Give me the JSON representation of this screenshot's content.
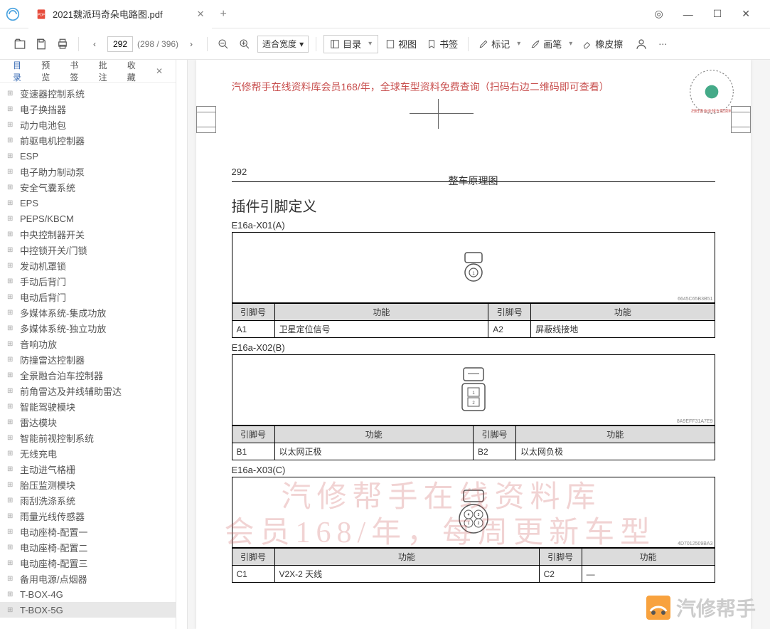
{
  "tab": {
    "title": "2021魏派玛奇朵电路图.pdf"
  },
  "toolbar": {
    "page_current": "292",
    "page_count": "(298 / 396)",
    "zoom": "适合宽度",
    "outline": "目录",
    "view": "视图",
    "bookmark": "书签",
    "annotate": "标记",
    "brush": "画笔",
    "eraser": "橡皮擦"
  },
  "side_tabs": {
    "outline": "目录",
    "preview": "预览",
    "bookmark": "书签",
    "annot": "批注",
    "fav": "收藏"
  },
  "tree": [
    "变速器控制系统",
    "电子换挡器",
    "动力电池包",
    "前驱电机控制器",
    "ESP",
    "电子助力制动泵",
    "安全气囊系统",
    "EPS",
    "PEPS/KBCM",
    "中央控制器开关",
    "中控锁开关/门锁",
    "发动机罩锁",
    "手动后背门",
    "电动后背门",
    "多媒体系统-集成功放",
    "多媒体系统-独立功放",
    "音响功放",
    "防撞雷达控制器",
    "全景融合泊车控制器",
    "前角雷达及并线辅助雷达",
    "智能驾驶模块",
    "雷达模块",
    "智能前视控制系统",
    "无线充电",
    "主动进气格栅",
    "胎压监测模块",
    "雨刮洗涤系统",
    "雨量光线传感器",
    "电动座椅-配置一",
    "电动座椅-配置二",
    "电动座椅-配置三",
    "备用电源/点烟器",
    "T-BOX-4G",
    "T-BOX-5G"
  ],
  "tree_selected_index": 33,
  "doc": {
    "banner": "汽修帮手在线资料库会员168/年，全球车型资料免费查询（扫码右边二维码即可查看）",
    "page_no": "292",
    "right_header": "整车原理图",
    "section_title": "插件引脚定义",
    "connectors": [
      {
        "label": "E16a-X01(A)",
        "serial": "6645C65B3B51",
        "headers": [
          "引脚号",
          "功能",
          "引脚号",
          "功能"
        ],
        "rows": [
          [
            "A1",
            "卫星定位信号",
            "A2",
            "屏蔽线接地"
          ]
        ]
      },
      {
        "label": "E16a-X02(B)",
        "serial": "8A9EFF31A7E9",
        "headers": [
          "引脚号",
          "功能",
          "引脚号",
          "功能"
        ],
        "rows": [
          [
            "B1",
            "以太网正极",
            "B2",
            "以太网负极"
          ]
        ]
      },
      {
        "label": "E16a-X03(C)",
        "serial": "4D7012509BA3",
        "headers": [
          "引脚号",
          "功能",
          "引脚号",
          "功能"
        ],
        "rows": [
          [
            "C1",
            "V2X-2 天线",
            "C2",
            "—"
          ]
        ]
      }
    ],
    "watermark1": "汽修帮手在线资料库",
    "watermark2": "会员168/年，每周更新车型",
    "brand_wm": "汽修帮手"
  }
}
